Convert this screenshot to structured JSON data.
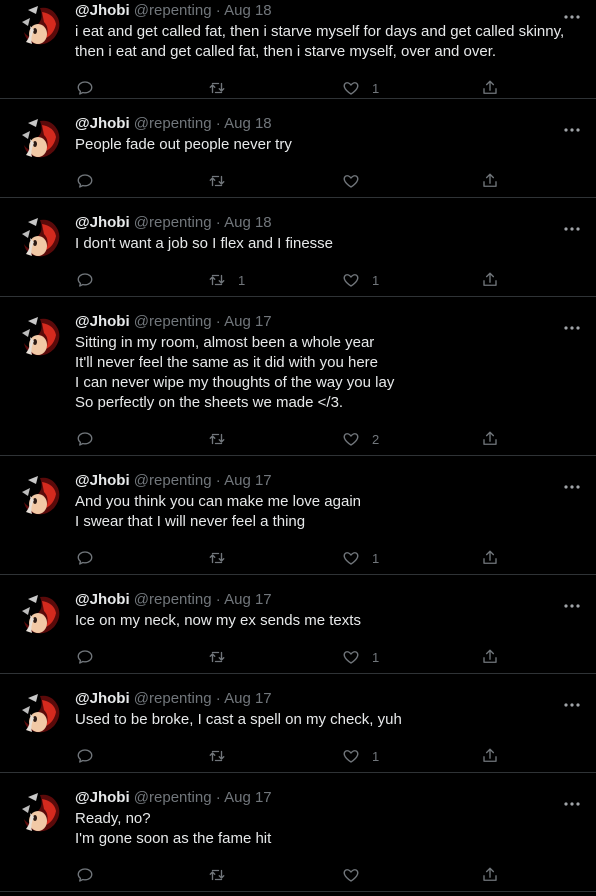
{
  "tweets": [
    {
      "author": "@Jhobi",
      "handle": "@repenting",
      "date": "Aug 18",
      "lines": [
        "i eat and get called fat, then i starve myself for days and get called skinny,",
        "then i eat and get called fat, then i starve myself, over and over."
      ],
      "retweets": "",
      "likes": "1"
    },
    {
      "author": "@Jhobi",
      "handle": "@repenting",
      "date": "Aug 18",
      "lines": [
        "People fade out people never try"
      ],
      "retweets": "",
      "likes": ""
    },
    {
      "author": "@Jhobi",
      "handle": "@repenting",
      "date": "Aug 18",
      "lines": [
        "I don't want a job so I flex and I finesse"
      ],
      "retweets": "1",
      "likes": "1"
    },
    {
      "author": "@Jhobi",
      "handle": "@repenting",
      "date": "Aug 17",
      "lines": [
        "Sitting in my room, almost been a whole year",
        "It'll never feel the same as it did with you here",
        "I can never wipe my thoughts of the way you lay",
        "So perfectly on the sheets we made </3."
      ],
      "retweets": "",
      "likes": "2"
    },
    {
      "author": "@Jhobi",
      "handle": "@repenting",
      "date": "Aug 17",
      "lines": [
        "And you think you can make me love again",
        "I swear that I will never feel a thing"
      ],
      "retweets": "",
      "likes": "1"
    },
    {
      "author": "@Jhobi",
      "handle": "@repenting",
      "date": "Aug 17",
      "lines": [
        "Ice on my neck, now my ex sends me texts"
      ],
      "retweets": "",
      "likes": "1"
    },
    {
      "author": "@Jhobi",
      "handle": "@repenting",
      "date": "Aug 17",
      "lines": [
        "Used to be broke, I cast a spell on my check, yuh"
      ],
      "retweets": "",
      "likes": "1"
    },
    {
      "author": "@Jhobi",
      "handle": "@repenting",
      "date": "Aug 17",
      "lines": [
        "Ready, no?",
        "I'm gone soon as the fame hit"
      ],
      "retweets": "",
      "likes": ""
    }
  ],
  "separator": "·",
  "icons": {
    "reply": "reply-icon",
    "retweet": "retweet-icon",
    "like": "heart-icon",
    "share": "share-icon",
    "more": "more-options-icon"
  },
  "colors": {
    "background": "#000000",
    "text": "#e7e9ea",
    "muted": "#71767b",
    "divider": "#2f3336"
  }
}
